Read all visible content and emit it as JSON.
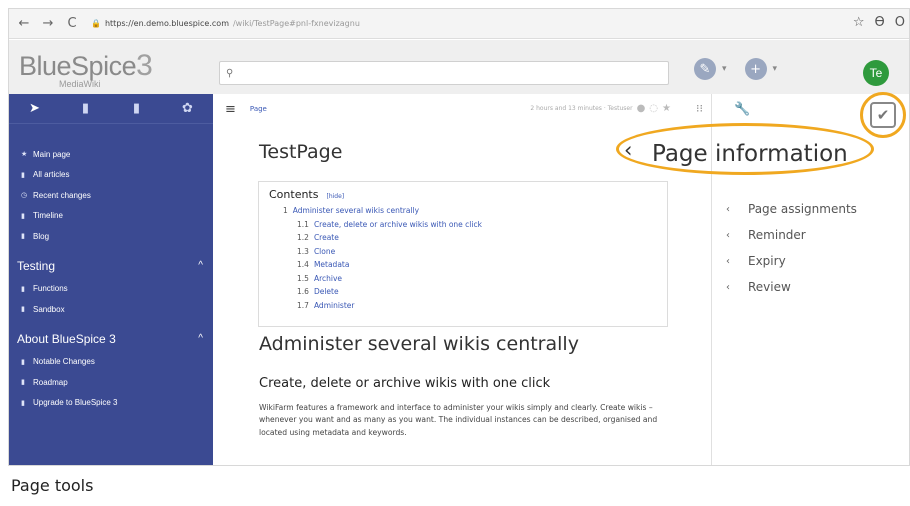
{
  "browser": {
    "back": "←",
    "forward": "→",
    "reload": "C",
    "lock": "🔒",
    "url_host": "https://en.demo.bluespice.com",
    "url_path": "/wiki/TestPage#pnl-fxnevizagnu",
    "star": "☆",
    "right_icon_1": "ϴ",
    "right_icon_2": "O"
  },
  "header": {
    "logo_word": "BlueSpice",
    "logo_number": "3",
    "logo_sub": "MediaWiki",
    "search_icon": "⚲",
    "avatar_text": "Te"
  },
  "sidebar": {
    "tabs": [
      "➤",
      "▮",
      "▮",
      "✿"
    ],
    "items": [
      {
        "icon": "★",
        "label": "Main page"
      },
      {
        "icon": "▮",
        "label": "All articles"
      },
      {
        "icon": "◷",
        "label": "Recent changes"
      },
      {
        "icon": "▮",
        "label": "Timeline"
      },
      {
        "icon": "▮",
        "label": "Blog"
      }
    ],
    "section_testing": "Testing",
    "testing_items": [
      {
        "icon": "▮",
        "label": "Functions"
      },
      {
        "icon": "▮",
        "label": "Sandbox"
      }
    ],
    "section_about": "About BlueSpice 3",
    "about_items": [
      {
        "icon": "▮",
        "label": "Notable Changes"
      },
      {
        "icon": "▮",
        "label": "Roadmap"
      },
      {
        "icon": "▮",
        "label": "Upgrade to BlueSpice 3"
      }
    ]
  },
  "content": {
    "breadcrumb": "Page",
    "meta_text": "2 hours and 13 minutes · Testuser",
    "page_title": "TestPage",
    "toc": {
      "title": "Contents",
      "hide": "[hide]",
      "entries": [
        {
          "num": "1",
          "label": "Administer several wikis centrally"
        },
        {
          "num": "1.1",
          "label": "Create, delete or archive wikis with one click"
        },
        {
          "num": "1.2",
          "label": "Create"
        },
        {
          "num": "1.3",
          "label": "Clone"
        },
        {
          "num": "1.4",
          "label": "Metadata"
        },
        {
          "num": "1.5",
          "label": "Archive"
        },
        {
          "num": "1.6",
          "label": "Delete"
        },
        {
          "num": "1.7",
          "label": "Administer"
        }
      ]
    },
    "heading1": "Administer several wikis centrally",
    "heading2": "Create, delete or archive wikis with one click",
    "paragraph": "WikiFarm features a framework and interface to administer your wikis simply and clearly. Create wikis – whenever you want and as many as you want. The individual instances can be described, organised and located using metadata and keywords."
  },
  "right_panel": {
    "title": "Page information",
    "items": [
      "Page assignments",
      "Reminder",
      "Expiry",
      "Review"
    ]
  },
  "caption": "Page tools",
  "colors": {
    "sidebar_bg": "#3b4a92",
    "highlight": "#f0a820",
    "link": "#3a58b5",
    "avatar_bg": "#2f9a3d"
  }
}
